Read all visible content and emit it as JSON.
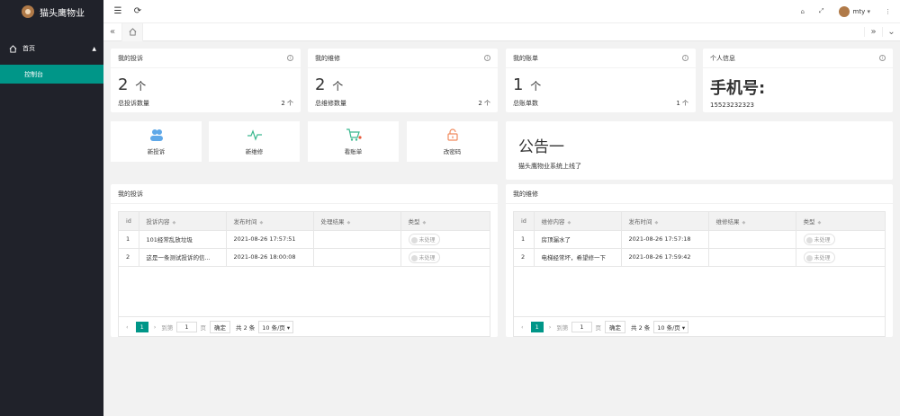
{
  "app": {
    "title": "猫头鹰物业"
  },
  "sidebar": {
    "menu": "首页",
    "sub": "控制台"
  },
  "header": {
    "user": "mty"
  },
  "stats": [
    {
      "title": "我的投诉",
      "num": "2",
      "unit": "个",
      "label": "总投诉数量",
      "right": "2 个"
    },
    {
      "title": "我的维修",
      "num": "2",
      "unit": "个",
      "label": "总维修数量",
      "right": "2 个"
    },
    {
      "title": "我的账单",
      "num": "1",
      "unit": "个",
      "label": "总账单数",
      "right": "1 个"
    },
    {
      "title": "个人信息",
      "phone": "手机号:",
      "label": "15523232323"
    }
  ],
  "shortcuts": [
    "新投诉",
    "新维修",
    "看账单",
    "改密码"
  ],
  "notice": {
    "title": "公告一",
    "text": "猫头鹰物业系统上线了"
  },
  "complaints": {
    "title": "我的投诉",
    "cols": [
      "id",
      "投诉内容",
      "发布时间",
      "处理结果",
      "类型"
    ],
    "rows": [
      [
        "1",
        "101经常乱放垃圾",
        "2021-08-26 17:57:51",
        "",
        "未处理"
      ],
      [
        "2",
        "这是一条测试投诉的信...",
        "2021-08-26 18:00:08",
        "",
        "未处理"
      ]
    ]
  },
  "repairs": {
    "title": "我的维修",
    "cols": [
      "id",
      "维修内容",
      "发布时间",
      "维修结果",
      "类型"
    ],
    "rows": [
      [
        "1",
        "房顶漏水了",
        "2021-08-26 17:57:18",
        "",
        "未处理"
      ],
      [
        "2",
        "电梯经常坏，希望修一下",
        "2021-08-26 17:59:42",
        "",
        "未处理"
      ]
    ]
  },
  "pager": {
    "page": "1",
    "goto": "到第",
    "pageval": "1",
    "pageunit": "页",
    "confirm": "确定",
    "total": "共 2 条",
    "size": "10 条/页"
  }
}
